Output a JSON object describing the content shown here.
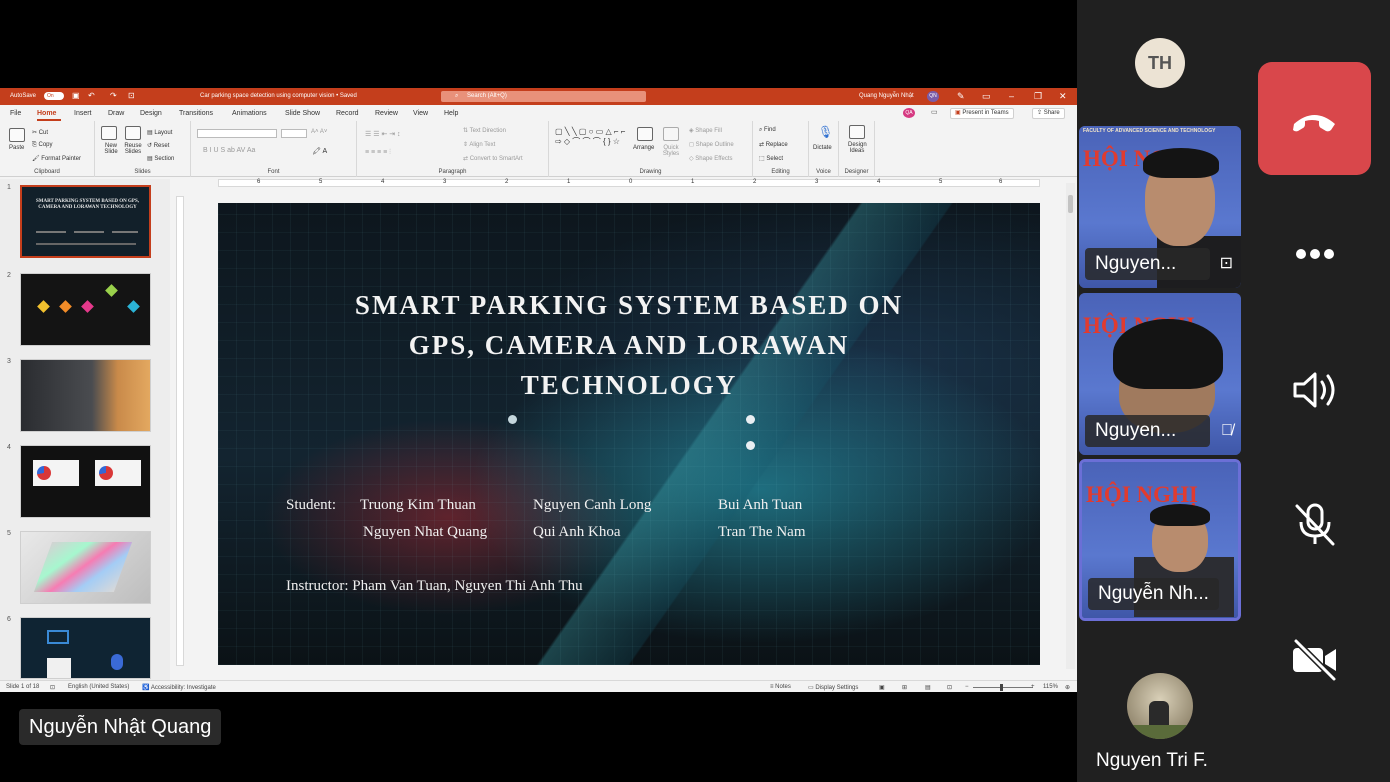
{
  "ppt": {
    "titlebar": {
      "autosave_label": "AutoSave",
      "autosave_state": "On",
      "doc_title": "Car parking space detection using computer vision",
      "saved_status": "• Saved",
      "search_placeholder": "Search (Alt+Q)",
      "user_name": "Quang Nguyễn Nhật",
      "user_initials": "QN"
    },
    "menu_tabs": [
      "File",
      "Home",
      "Insert",
      "Draw",
      "Design",
      "Transitions",
      "Animations",
      "Slide Show",
      "Record",
      "Review",
      "View",
      "Help"
    ],
    "active_tab": "Home",
    "present_in_teams": "Present in Teams",
    "share": "Share",
    "ribbon": {
      "clipboard": {
        "paste": "Paste",
        "cut": "Cut",
        "copy": "Copy",
        "format_painter": "Format Painter",
        "group": "Clipboard"
      },
      "slides": {
        "new_slide": "New Slide",
        "reuse": "Reuse Slides",
        "layout": "Layout",
        "reset": "Reset",
        "section": "Section",
        "group": "Slides"
      },
      "font": {
        "group": "Font"
      },
      "paragraph": {
        "text_direction": "Text Direction",
        "align_text": "Align Text",
        "convert_smartart": "Convert to SmartArt",
        "group": "Paragraph"
      },
      "drawing": {
        "arrange": "Arrange",
        "quick_styles": "Quick Styles",
        "shape_fill": "Shape Fill",
        "shape_outline": "Shape Outline",
        "shape_effects": "Shape Effects",
        "group": "Drawing"
      },
      "editing": {
        "find": "Find",
        "replace": "Replace",
        "select": "Select",
        "group": "Editing"
      },
      "voice": {
        "dictate": "Dictate",
        "group": "Voice"
      },
      "designer": {
        "design_ideas": "Design Ideas",
        "group": "Designer"
      }
    },
    "ruler_numbers": [
      "6",
      "5",
      "4",
      "3",
      "2",
      "1",
      "0",
      "1",
      "2",
      "3",
      "4",
      "5",
      "6"
    ],
    "slide_numbers": [
      "1",
      "2",
      "3",
      "4",
      "5",
      "6"
    ],
    "thumb1_title": "SMART PARKING SYSTEM BASED ON GPS, CAMERA AND LORAWAN TECHNOLOGY",
    "slide": {
      "title_line1": "SMART PARKING SYSTEM BASED ON",
      "title_line2": "GPS, CAMERA AND LORAWAN",
      "title_line3": "TECHNOLOGY",
      "student_label": "Student:",
      "students": [
        "Truong Kim Thuan",
        "Nguyen Canh Long",
        "Bui Anh Tuan",
        "Nguyen Nhat Quang",
        "Qui Anh Khoa",
        "Tran The Nam"
      ],
      "instructor": "Instructor: Pham Van Tuan, Nguyen Thi Anh Thu"
    },
    "status": {
      "slide_of": "Slide 1 of 18",
      "language": "English (United States)",
      "accessibility": "Accessibility: Investigate",
      "notes": "Notes",
      "display_settings": "Display Settings",
      "zoom": "115%"
    }
  },
  "presenter_name": "Nguyễn Nhật Quang",
  "participants": {
    "avatar_initials": "TH",
    "tile_banner_heading": "HỘI NGHỊ",
    "tile1_sub": "FACULTY OF ADVANCED SCIENCE AND TECHNOLOGY",
    "tile_names": [
      "Nguyen...",
      "Nguyen...",
      "Nguyễn Nh..."
    ],
    "bottom_name": "Nguyen Tri F."
  },
  "colors": {
    "ppt_accent": "#c43e1c",
    "end_call": "#d9474b",
    "active_speaker": "#6b6fd6"
  },
  "icons": [
    "end-call-icon",
    "more-icon",
    "speaker-icon",
    "mic-off-icon",
    "camera-off-icon",
    "pin-icon",
    "muted-mic-icon"
  ]
}
